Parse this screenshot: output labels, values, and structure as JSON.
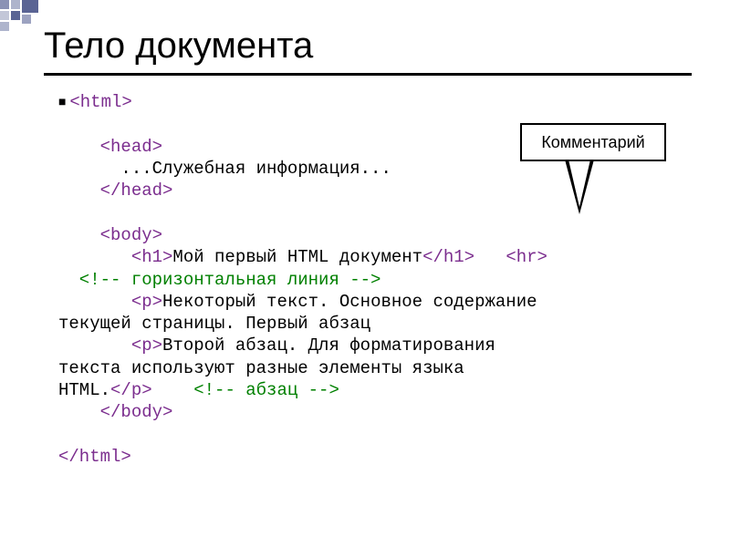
{
  "title": "Тело документа",
  "callout": "Комментарий",
  "code": {
    "l01a": "<html>",
    "l02a": "    <head>",
    "l03a": "      ...Служебная информация...",
    "l04a": "    </head>",
    "l05a": "    <body>",
    "l06a": "       <h1>",
    "l06b": "Мой первый HTML документ",
    "l06c": "</h1>",
    "l06d": "   ",
    "l06e": "<hr>",
    "l07a": "  <!-- горизонтальная линия -->",
    "l08a": "       <p>",
    "l08b": "Некоторый текст. Основное содержание",
    "l09a": "текущей страницы. Первый абзац",
    "l10a": "       <p>",
    "l10b": "Второй абзац. Для форматирования",
    "l11a": "текста используют разные элементы языка",
    "l12a": "HTML.",
    "l12b": "</p>",
    "l12c": "    ",
    "l12d": "<!-- абзац -->",
    "l13a": "    </body>",
    "l14a": "</html>"
  }
}
